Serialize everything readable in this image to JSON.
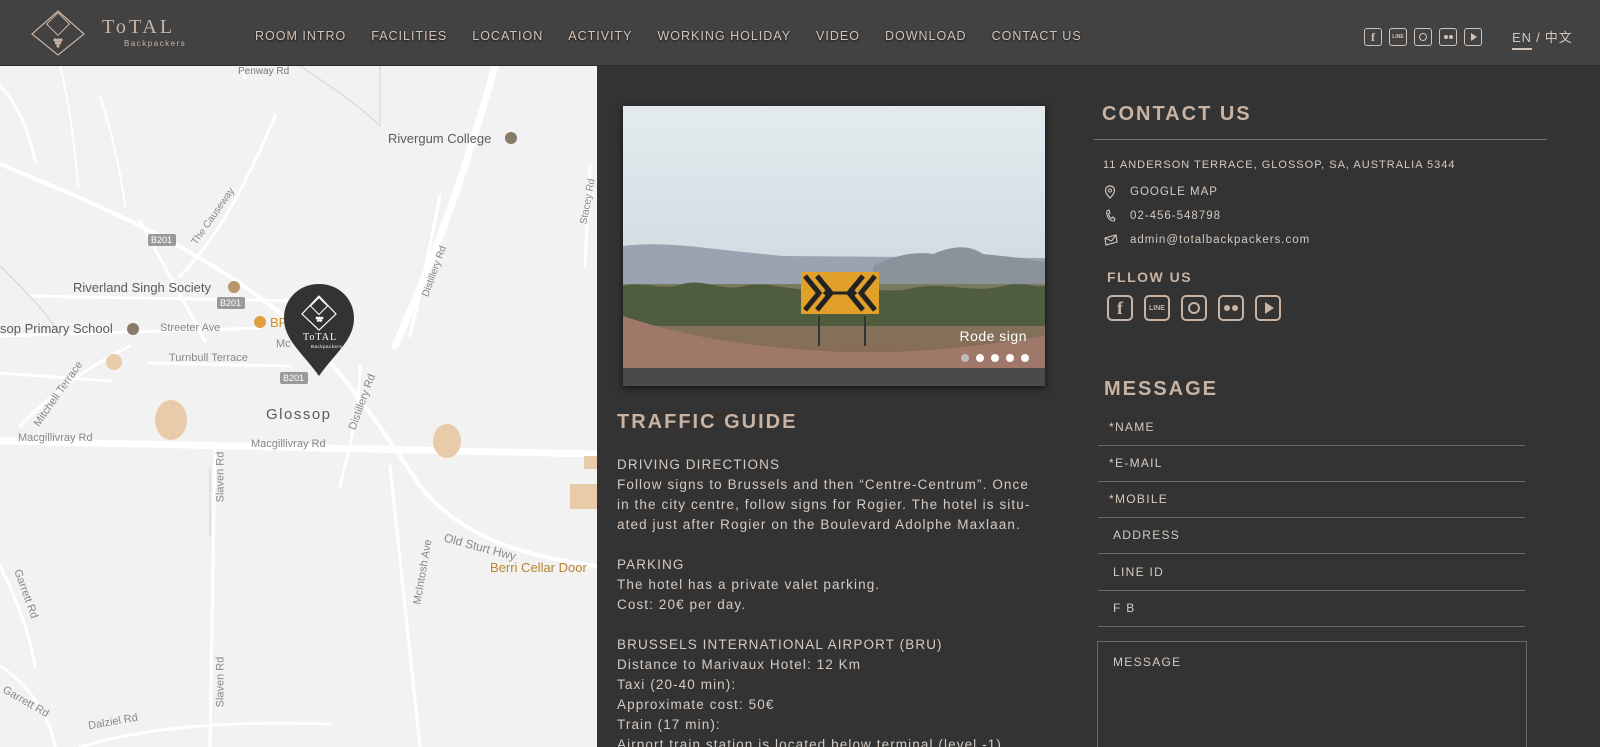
{
  "header": {
    "logo_title": "ToTAL",
    "logo_subtitle": "Backpackers",
    "nav": [
      "ROOM INTRO",
      "FACILITIES",
      "LOCATION",
      "ACTIVITY",
      "WORKING HOLIDAY",
      "VIDEO",
      "DOWNLOAD",
      "CONTACT US"
    ],
    "social_icons": [
      "facebook-icon",
      "line-icon",
      "instagram-icon",
      "flickr-icon",
      "youtube-icon"
    ],
    "lang_en": "EN",
    "lang_sep": "/",
    "lang_zh": "中文"
  },
  "map": {
    "labels": {
      "penway": "Penway Rd",
      "rivergum": "Rivergum College",
      "causeway": "The Causeway",
      "stacey": "Stacey Rd",
      "distillery": "Distillery Rd",
      "b201_a": "B201",
      "b201_b": "B201",
      "b201_c": "B201",
      "riverland": "Riverland Singh Society",
      "primary": "sop Primary School",
      "streeter": "Streeter Ave",
      "bp": "BP",
      "mc": "Mc",
      "turnbull": "Turnbull Terrace",
      "mitchell": "Mitchell Terrace",
      "glossop": "Glossop",
      "distillery2": "Distillery Rd",
      "macgill1": "Macgillivray Rd",
      "macgill2": "Macgillivray Rd",
      "slaven1": "Slaven Rd",
      "slaven2": "Slaven Rd",
      "oldsturt": "Old Sturt Hwy",
      "mcintosh": "McIntosh Ave",
      "berri": "Berri Cellar Door",
      "garrett1": "Garrett Rd",
      "garrett2": "Garrett Rd",
      "dalziel": "Dalziel Rd"
    },
    "pin_title": "ToTAL",
    "pin_subtitle": "Backpackers"
  },
  "slider": {
    "caption": "Rode sign",
    "dots": 5,
    "active_dot": 1
  },
  "traffic": {
    "title": "TRAFFIC GUIDE",
    "driving_heading": "DRIVING DIRECTIONS",
    "driving_lines": [
      "Follow signs to Brussels and then “Centre-Centrum”. Once",
      "in the city centre, follow signs for Rogier. The hotel is situ-",
      "ated just after Rogier on the Boulevard Adolphe Maxlaan."
    ],
    "parking_heading": "PARKING",
    "parking_lines": [
      "The hotel has a private valet parking.",
      "Cost: 20€ per day."
    ],
    "airport_heading": "BRUSSELS INTERNATIONAL AIRPORT (BRU)",
    "airport_lines": [
      "Distance to Marivaux Hotel: 12 Km",
      "Taxi (20-40 min):",
      "Approximate cost: 50€",
      "Train (17 min):",
      "Airport train station is located below terminal (level -1)."
    ]
  },
  "contact": {
    "title": "CONTACT US",
    "address": "11 ANDERSON TERRACE, GLOSSOP, SA, AUSTRALIA 5344",
    "google_map": "GOOGLE MAP",
    "phone": "02-456-548798",
    "email": "admin@totalbackpackers.com",
    "follow_title": "FLLOW US"
  },
  "message": {
    "title": "MESSAGE",
    "fields": [
      "*NAME",
      "*E-MAIL",
      "*MOBILE",
      "ADDRESS",
      "LINE ID",
      "F B"
    ],
    "message_label": "MESSAGE"
  },
  "colors": {
    "accent": "#c9b3a3",
    "background": "#333333",
    "header": "#424242",
    "map": "#f2f2f2"
  }
}
